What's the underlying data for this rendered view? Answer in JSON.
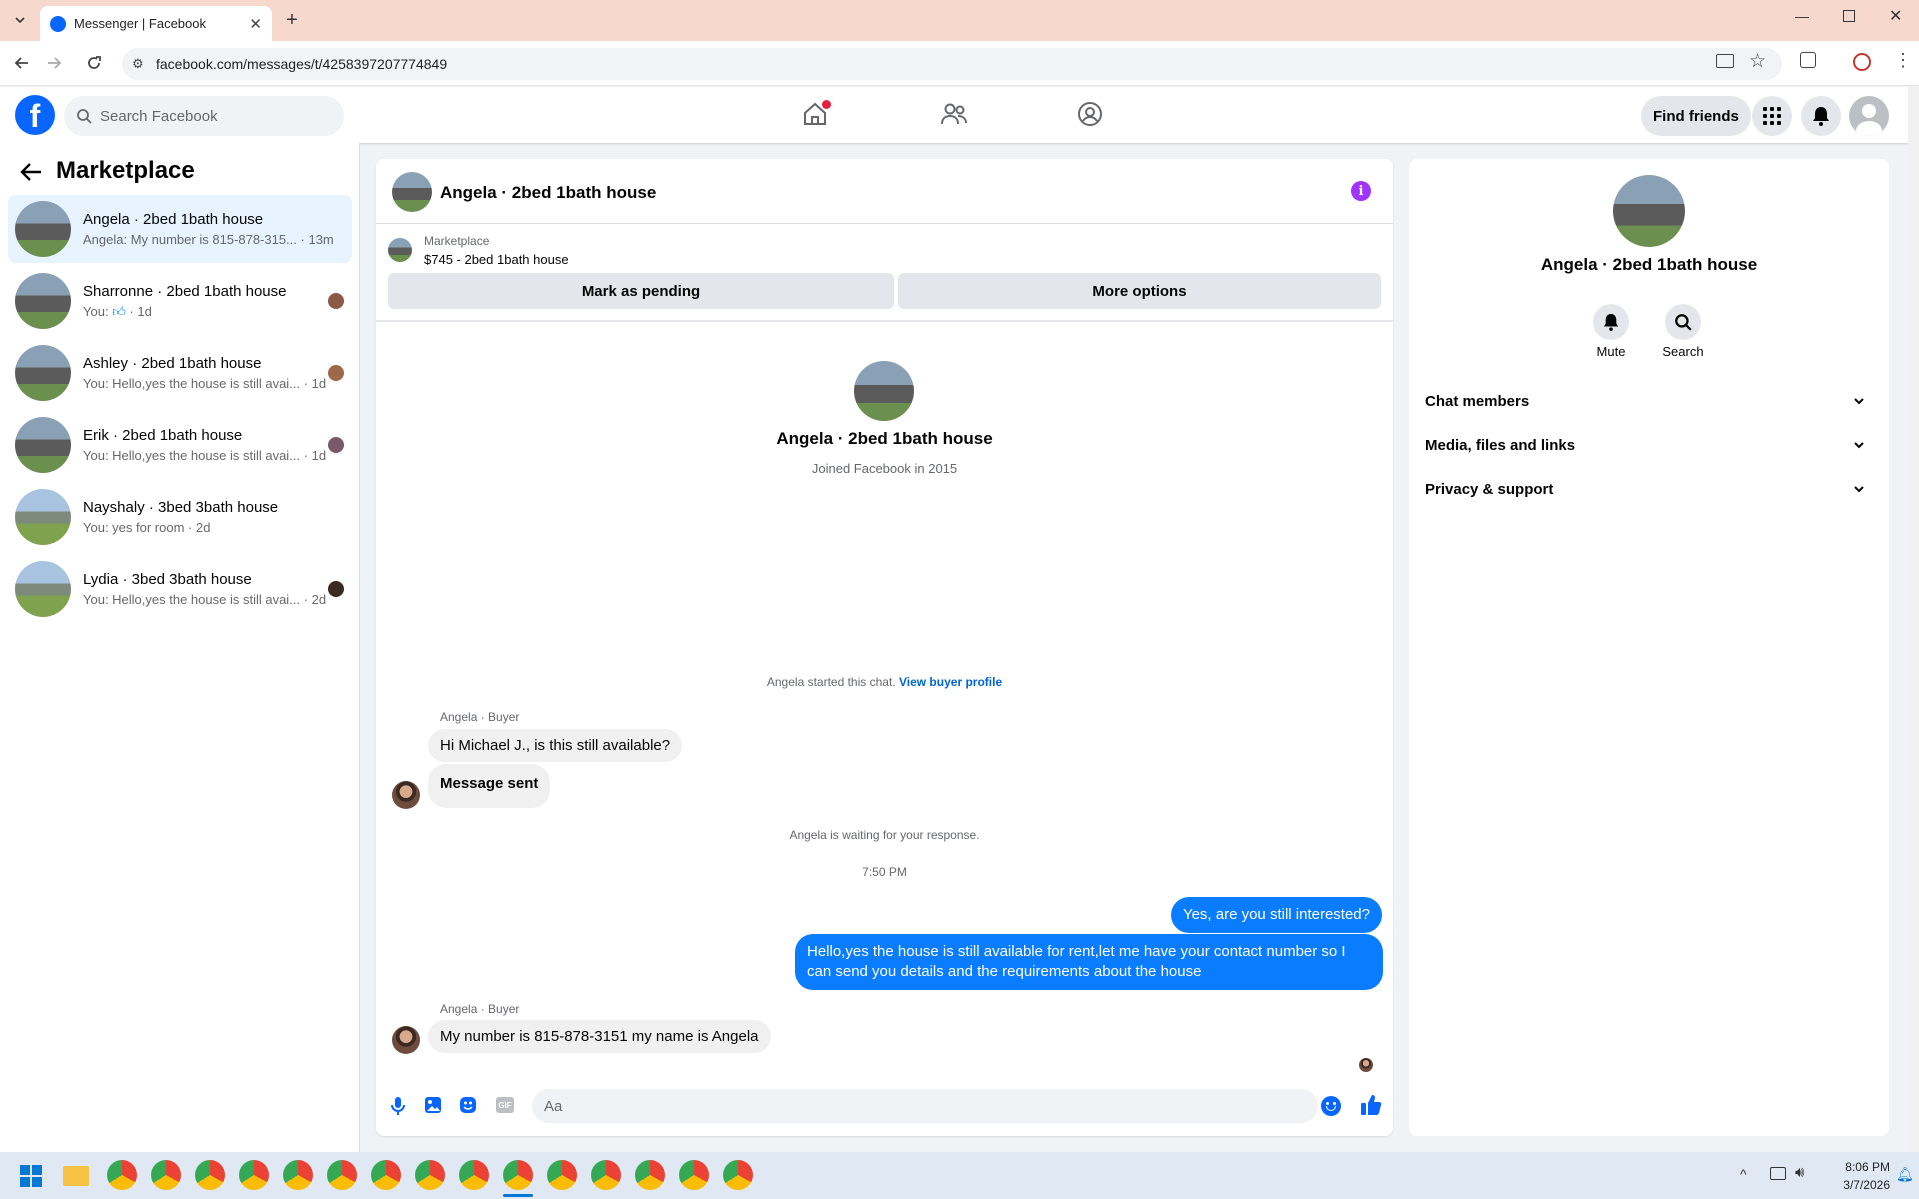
{
  "browser": {
    "tab_title": "Messenger | Facebook",
    "url": "facebook.com/messages/t/4258397207774849"
  },
  "header": {
    "search_placeholder": "Search Facebook",
    "find_friends": "Find friends"
  },
  "sidebar": {
    "title": "Marketplace",
    "conversations": [
      {
        "name": "Angela · 2bed 1bath house",
        "preview": "Angela: My number is 815-878-315...",
        "time": "· 13m"
      },
      {
        "name": "Sharronne · 2bed 1bath house",
        "preview": "You:",
        "time": "· 1d"
      },
      {
        "name": "Ashley · 2bed 1bath house",
        "preview": "You: Hello,yes the house is still avai...",
        "time": "· 1d"
      },
      {
        "name": "Erik · 2bed 1bath house",
        "preview": "You: Hello,yes the house is still avai...",
        "time": "· 1d"
      },
      {
        "name": "Nayshaly · 3bed 3bath house",
        "preview": "You: yes for room",
        "time": "· 2d"
      },
      {
        "name": "Lydia · 3bed 3bath house",
        "preview": "You: Hello,yes the house is still avai...",
        "time": "· 2d"
      }
    ]
  },
  "chat": {
    "title": "Angela · 2bed 1bath house",
    "listing_source": "Marketplace",
    "listing_title": "$745 - 2bed 1bath house",
    "mark_pending": "Mark as pending",
    "more_options": "More options",
    "profile_name": "Angela · 2bed 1bath house",
    "joined": "Joined Facebook in 2015",
    "started": "Angela started this chat.",
    "view_buyer": "View buyer profile",
    "sender_label": "Angela · Buyer",
    "msg1": "Hi Michael J., is this still available?",
    "msg2": "Message sent",
    "waiting": "Angela is waiting for your response.",
    "timestamp": "7:50 PM",
    "out1": "Yes, are you still interested?",
    "out2": "Hello,yes the house is still available for rent,let me have your contact number so I can send you details and the requirements about the house",
    "sender_label2": "Angela · Buyer",
    "msg3": "My number is 815-878-3151 my name is Angela",
    "composer_placeholder": "Aa"
  },
  "details": {
    "name": "Angela · 2bed 1bath house",
    "mute": "Mute",
    "search": "Search",
    "sections": [
      "Chat members",
      "Media, files and links",
      "Privacy & support"
    ]
  },
  "taskbar": {
    "time": "8:06 PM",
    "date": "3/7/2026"
  },
  "colors": {
    "accent": "#0866ff",
    "bubble_out": "#0a7cff",
    "info": "#a033ff"
  }
}
